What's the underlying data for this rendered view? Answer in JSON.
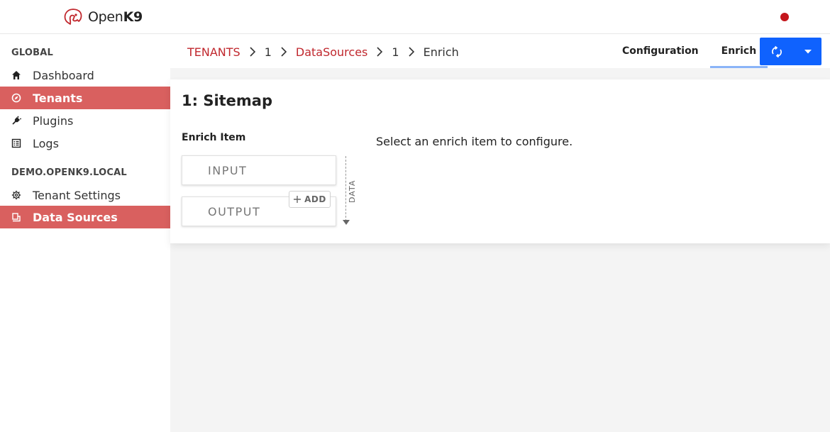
{
  "app": {
    "logo_prefix": "Open",
    "logo_bold": "K9",
    "status_color": "#c4161c"
  },
  "sidebar": {
    "sections": [
      {
        "title": "GLOBAL",
        "items": [
          {
            "label": "Dashboard",
            "icon": "home-icon",
            "active": false
          },
          {
            "label": "Tenants",
            "icon": "compass-icon",
            "active": true
          },
          {
            "label": "Plugins",
            "icon": "plug-icon",
            "active": false
          },
          {
            "label": "Logs",
            "icon": "list-icon",
            "active": false
          }
        ]
      },
      {
        "title": "DEMO.OPENK9.LOCAL",
        "items": [
          {
            "label": "Tenant Settings",
            "icon": "gear-icon",
            "active": false
          },
          {
            "label": "Data Sources",
            "icon": "database-icon",
            "active": true
          }
        ]
      }
    ],
    "active_color": "#d9605f"
  },
  "breadcrumb": {
    "items": [
      {
        "label": "TENANTS",
        "link": true
      },
      {
        "label": "1",
        "link": false
      },
      {
        "label": "DataSources",
        "link": true
      },
      {
        "label": "1",
        "link": false
      },
      {
        "label": "Enrich",
        "link": false
      }
    ]
  },
  "tabs": [
    {
      "label": "Configuration",
      "active": false
    },
    {
      "label": "Enrich",
      "active": true
    }
  ],
  "primary_color": "#0f62fe",
  "card": {
    "title": "1: Sitemap",
    "enrich_label": "Enrich Item",
    "input_label": "INPUT",
    "output_label": "OUTPUT",
    "add_label": "ADD",
    "data_label": "DATA",
    "hint": "Select an enrich item to configure."
  }
}
